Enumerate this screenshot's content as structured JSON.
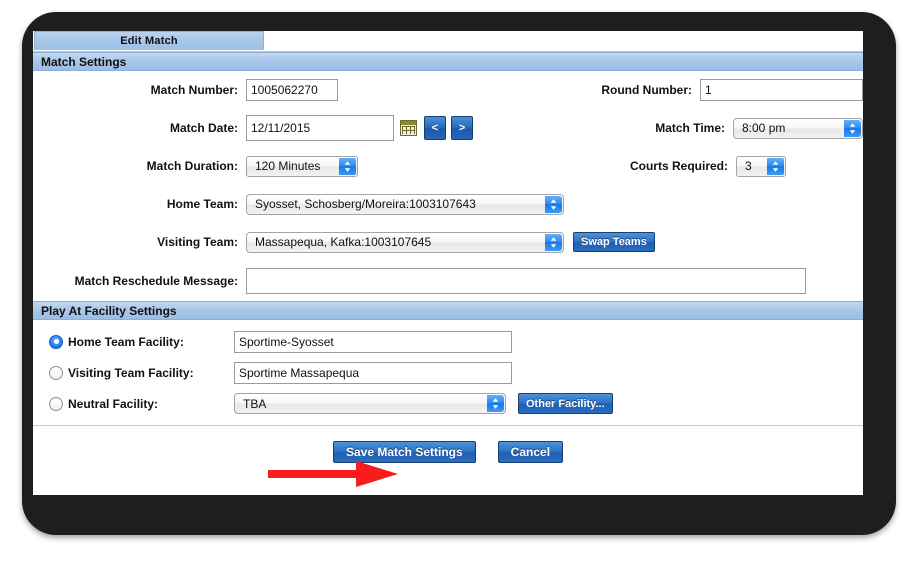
{
  "window": {
    "tab_label": "Edit Match"
  },
  "sections": {
    "match_settings": {
      "title": "Match Settings",
      "fields": {
        "match_number": {
          "label": "Match Number:",
          "value": "1005062270"
        },
        "round_number": {
          "label": "Round Number:",
          "value": "1"
        },
        "match_date": {
          "label": "Match Date:",
          "value": "12/11/2015"
        },
        "match_time": {
          "label": "Match Time:",
          "value": "8:00 pm"
        },
        "match_duration": {
          "label": "Match Duration:",
          "value": "120 Minutes"
        },
        "courts_required": {
          "label": "Courts Required:",
          "value": "3"
        },
        "home_team": {
          "label": "Home Team:",
          "value": "Syosset, Schosberg/Moreira:1003107643"
        },
        "visiting_team": {
          "label": "Visiting Team:",
          "value": "Massapequa, Kafka:1003107645"
        },
        "reschedule_message": {
          "label": "Match Reschedule Message:",
          "value": "",
          "placeholder": ""
        }
      },
      "buttons": {
        "prev_date": "<",
        "next_date": ">",
        "swap_teams": "Swap Teams"
      },
      "icons": {
        "calendar": "calendar-icon"
      }
    },
    "play_at_facility": {
      "title": "Play At Facility Settings",
      "options": [
        {
          "label": "Home Team Facility:",
          "value": "Sportime-Syosset",
          "selected": true,
          "control": "text"
        },
        {
          "label": "Visiting Team Facility:",
          "value": "Sportime Massapequa",
          "selected": false,
          "control": "text"
        },
        {
          "label": "Neutral Facility:",
          "value": "TBA",
          "selected": false,
          "control": "select"
        }
      ],
      "buttons": {
        "other_facility": "Other Facility..."
      }
    }
  },
  "footer": {
    "save_label": "Save Match Settings",
    "cancel_label": "Cancel"
  },
  "annotation": {
    "arrow_color": "#f81c1c",
    "points_to": "Save Match Settings"
  },
  "colors": {
    "header_blue": "#a9c7e9",
    "button_blue": "#2f73c4",
    "accent_select_blue": "#1878e8",
    "frame_dark": "#1e1e1e"
  }
}
